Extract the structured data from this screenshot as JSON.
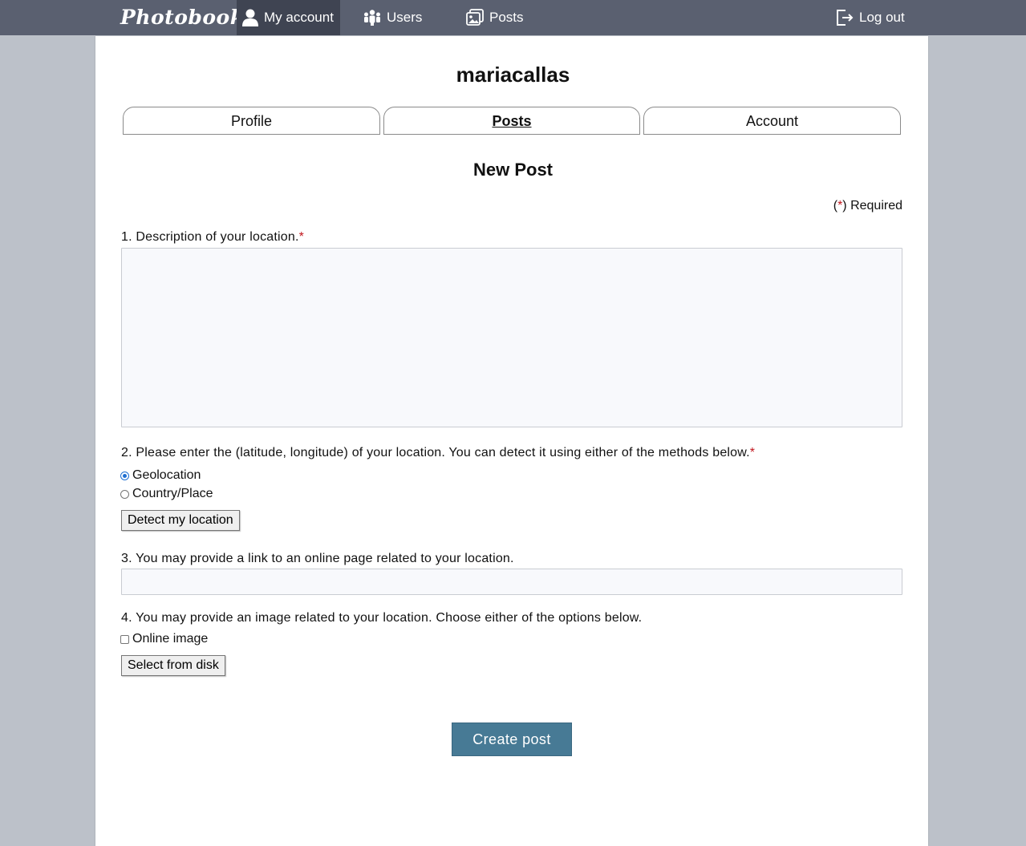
{
  "nav": {
    "brand": "Photobook",
    "my_account": "My account",
    "users": "Users",
    "posts": "Posts",
    "logout": "Log out"
  },
  "profile": {
    "username": "mariacallas"
  },
  "tabs": [
    {
      "label": "Profile"
    },
    {
      "label": "Posts"
    },
    {
      "label": "Account"
    }
  ],
  "form": {
    "heading": "New Post",
    "required_prefix": "(",
    "required_star": "*",
    "required_suffix": ") Required",
    "q1_label": "1. Description of your location.",
    "q1_star": "*",
    "q1_value": "",
    "q2_label": "2. Please enter the (latitude, longitude) of your location. You can detect it using either of the methods below.",
    "q2_star": "*",
    "q2_options": [
      {
        "label": "Geolocation",
        "checked": true
      },
      {
        "label": "Country/Place",
        "checked": false
      }
    ],
    "detect_button": "Detect my location",
    "q3_label": "3. You may provide a link to an online page related to your location.",
    "q3_value": "",
    "q4_label": "4. You may provide an image related to your location. Choose either of the options below.",
    "online_image_label": "Online image",
    "online_image_checked": false,
    "select_disk_button": "Select from disk",
    "submit_button": "Create post"
  },
  "colors": {
    "topbar": "#5a6070",
    "active_nav": "#3f4452",
    "background": "#bcc1c9",
    "required_star": "#c0151c",
    "submit": "#477a95"
  }
}
